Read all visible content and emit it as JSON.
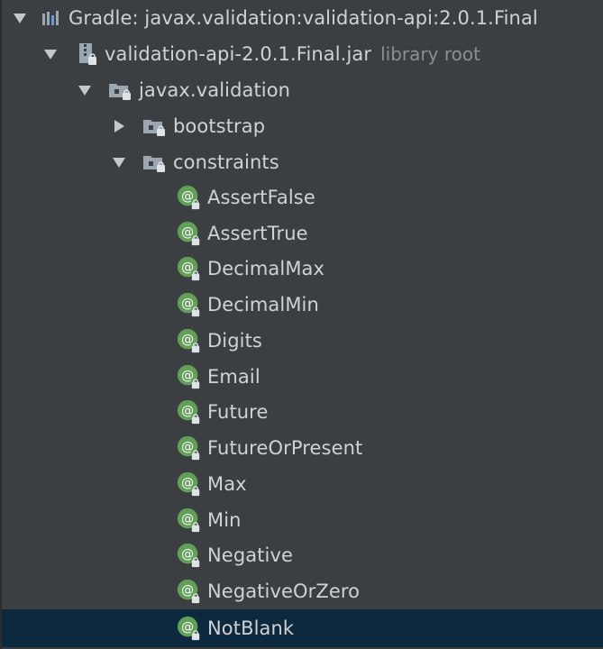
{
  "tree": {
    "gradle": {
      "label": "Gradle: javax.validation:validation-api:2.0.1.Final",
      "icon": "gradle-library-icon"
    },
    "jar": {
      "label": "validation-api-2.0.1.Final.jar",
      "hint": "library root",
      "icon": "jar-icon"
    },
    "package_root": {
      "label": "javax.validation",
      "icon": "package-icon"
    },
    "bootstrap": {
      "label": "bootstrap",
      "icon": "package-icon"
    },
    "constraints": {
      "label": "constraints",
      "icon": "package-icon"
    },
    "annotations": [
      {
        "label": "AssertFalse"
      },
      {
        "label": "AssertTrue"
      },
      {
        "label": "DecimalMax"
      },
      {
        "label": "DecimalMin"
      },
      {
        "label": "Digits"
      },
      {
        "label": "Email"
      },
      {
        "label": "Future"
      },
      {
        "label": "FutureOrPresent"
      },
      {
        "label": "Max"
      },
      {
        "label": "Min"
      },
      {
        "label": "Negative"
      },
      {
        "label": "NegativeOrZero"
      },
      {
        "label": "NotBlank"
      }
    ],
    "annotation_icon": "annotation-icon",
    "selected_item": "NotBlank"
  },
  "colors": {
    "background": "#3c3f41",
    "selection": "#0d293e",
    "text": "#cfd3d6",
    "hint_text": "#8c8f91",
    "annotation_green": "#62a05a",
    "folder_gray": "#9aa7b0"
  }
}
